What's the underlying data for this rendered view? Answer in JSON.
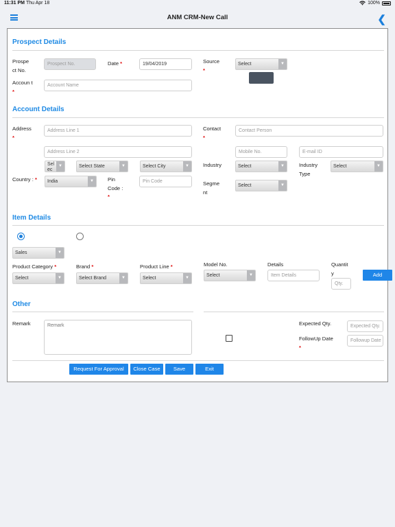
{
  "status": {
    "time": "11:31 PM",
    "day": "Thu Apr 18",
    "battery": "100%"
  },
  "nav": {
    "title": "ANM CRM-New Call"
  },
  "prospect": {
    "title": "Prospect Details",
    "prospect_no_label": "Prospe ct No.",
    "prospect_no_placeholder": "Prospect No.",
    "date_label": "Date",
    "date_value": "19/04/2019",
    "source_label": "Source",
    "source_value": "Select",
    "account_label": "Accoun t",
    "account_placeholder": "Account Name"
  },
  "account_details": {
    "title": "Account Details",
    "address_label": "Address",
    "address1_placeholder": "Address Line 1",
    "address2_placeholder": "Address Line 2",
    "country_select": "Sel ec",
    "state_select": "Select State",
    "city_select": "Select City",
    "country_label": "Country :",
    "country_value": "India",
    "pin_label": "Pin Code :",
    "pin_placeholder": "Pin Code",
    "contact_label": "Contact",
    "contact_placeholder": "Contact Person",
    "mobile_placeholder": "Mobile No.",
    "email_placeholder": "E-mail ID",
    "industry_label": "Industry",
    "industry_select": "Select",
    "industry_type_label": "Industry Type",
    "industry_type_select": "Select",
    "segment_label": "Segme nt",
    "segment_select": "Select"
  },
  "item": {
    "title": "Item Details",
    "type_select": "Sales",
    "product_category_label": "Product Category",
    "product_category_select": "Select",
    "brand_label": "Brand",
    "brand_select": "Select Brand",
    "product_line_label": "Product Line",
    "product_line_select": "Select",
    "model_label": "Model No.",
    "model_select": "Select",
    "details_label": "Details",
    "details_placeholder": "Item Details",
    "quantity_label": "Quantit y",
    "qty_placeholder": "Qty.",
    "add_label": "Add"
  },
  "other": {
    "title": "Other",
    "remark_label": "Remark",
    "remark_placeholder": "Remark",
    "expected_label": "Expected Qty.",
    "expected_placeholder": "Expected Qty.",
    "followup_label": "FollowUp Date",
    "followup_placeholder": "Followup Date"
  },
  "actions": {
    "approval": "Request For Approval",
    "close": "Close Case",
    "save": "Save",
    "exit": "Exit"
  },
  "colors": {
    "accent": "#1f86e8",
    "section_title": "#1f8ae4",
    "required": "#e01010"
  },
  "icons": {
    "menu": "hamburger-icon",
    "back": "chevron-left-icon",
    "wifi": "wifi-icon",
    "battery": "battery-icon"
  }
}
